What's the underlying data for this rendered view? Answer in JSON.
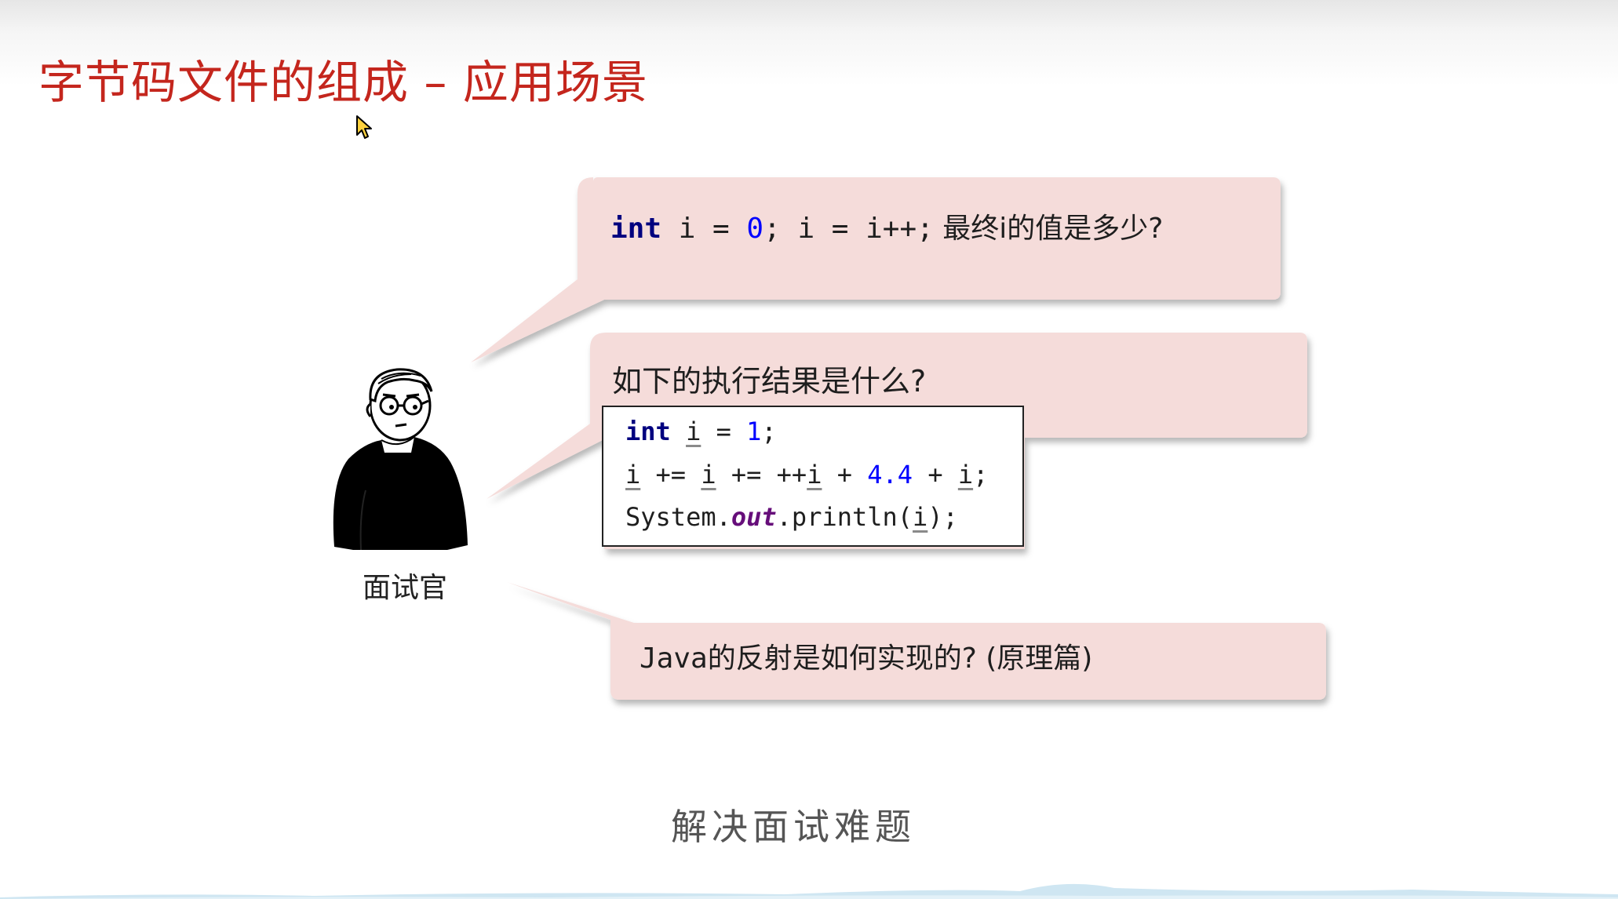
{
  "slide": {
    "title": "字节码文件的组成 – 应用场景",
    "subtitle": "解决面试难题"
  },
  "interviewer": {
    "label": "面试官",
    "icon": "interviewer-person-icon"
  },
  "question1": {
    "code_kw": "int",
    "code_a": " i = ",
    "code_num": "0",
    "code_b": "; i = i++;",
    "text": " 最终i的值是多少?"
  },
  "question2": {
    "text": "如下的执行结果是什么?",
    "line1": {
      "kw": "int",
      "sp": " ",
      "var": "i",
      "eq": " = ",
      "num": "1",
      "end": ";"
    },
    "line2": {
      "v1": "i",
      "p1": " += ",
      "v2": "i",
      "p2": " += ++",
      "v3": "i",
      "p3": " + ",
      "num": "4.4",
      "p4": " + ",
      "v4": "i",
      "end": ";"
    },
    "line3": {
      "a": "System.",
      "field": "out",
      "b": ".println(",
      "var": "i",
      "end": ");"
    }
  },
  "question3": {
    "code": "Java",
    "text": "的反射是如何实现的? (原理篇)"
  },
  "colors": {
    "title": "#c4261d",
    "bubble": "#f5dcda",
    "keyword": "#00007f",
    "number": "#0000ff",
    "field": "#660e7a"
  }
}
